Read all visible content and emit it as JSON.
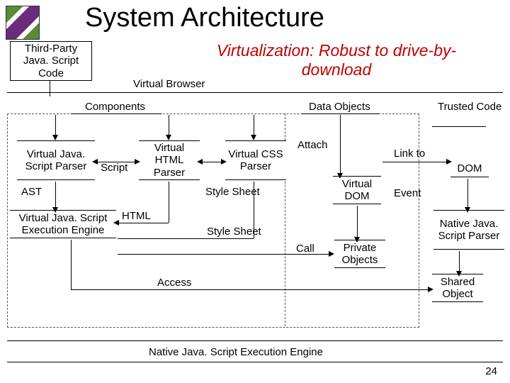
{
  "title": "System Architecture",
  "subtitle": "Virtualization: Robust to drive-by-download",
  "boxes": {
    "third_party": "Third-Party Java. Script Code",
    "virtual_browser": "Virtual Browser",
    "components": "Components",
    "data_objects": "Data Objects",
    "trusted_code": "Trusted Code",
    "vjs_parser": "Virtual Java. Script Parser",
    "vhtml_parser": "Virtual HTML Parser",
    "vcss_parser": "Virtual CSS Parser",
    "virtual_dom": "Virtual DOM",
    "dom": "DOM",
    "native_js_parser": "Native Java. Script Parser",
    "private_objects": "Private Objects",
    "shared_object": "Shared Object",
    "vjs_exec": "Virtual Java. Script Execution Engine",
    "native_exec": "Native Java. Script Execution Engine"
  },
  "labels": {
    "ast": "AST",
    "script": "Script",
    "html": "HTML",
    "style_sheet1": "Style Sheet",
    "style_sheet2": "Style Sheet",
    "attach": "Attach",
    "link_to": "Link to",
    "event": "Event",
    "call": "Call",
    "access": "Access"
  },
  "slide_number": "24"
}
